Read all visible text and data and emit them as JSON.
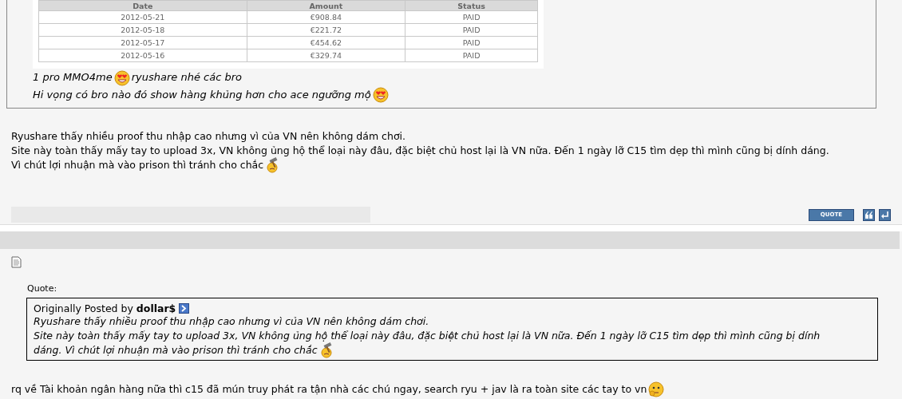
{
  "post_1": {
    "quote_table": {
      "columns": [
        "Date",
        "Amount",
        "Status"
      ],
      "rows": [
        [
          "2012-05-21",
          "€908.84",
          "PAID"
        ],
        [
          "2012-05-18",
          "€221.72",
          "PAID"
        ],
        [
          "2012-05-17",
          "€454.62",
          "PAID"
        ],
        [
          "2012-05-16",
          "€329.74",
          "PAID"
        ]
      ]
    },
    "quote_lines": [
      [
        {
          "kind": "text",
          "text": "1 pro MMO4me"
        },
        {
          "kind": "love_smiley"
        },
        {
          "kind": "text",
          "text": "ryushare nhé các bro"
        }
      ],
      [
        {
          "kind": "text",
          "text": "Hi vọng có bro nào đó show hàng khủng hơn cho ace ngưỡng mộ"
        },
        {
          "kind": "love_smiley"
        }
      ]
    ],
    "message_lines": [
      [
        {
          "kind": "text",
          "text": "Ryushare thấy nhiều proof thu nhập cao nhưng vì của VN nên không dám chơi."
        }
      ],
      [
        {
          "kind": "text",
          "text": "Site này toàn thấy mấy tay to upload 3x, VN không ủng hộ thể loại này đâu, đặc biệt chủ host lại là VN nữa. Đến 1 ngày lỡ C15 tìm dẹp thì mình cũng bị dính dáng."
        }
      ],
      [
        {
          "kind": "text",
          "text": "Vì chút lợi nhuận mà vào prison thì tránh cho chắc"
        },
        {
          "kind": "hammer_smiley"
        }
      ]
    ],
    "quote_button": "QUOTE"
  },
  "post_2": {
    "quote_label": "Quote:",
    "posted_by_label": "Originally Posted by",
    "author": "dollar$",
    "quote_lines": [
      [
        {
          "kind": "text",
          "text": "Ryushare thấy nhiều proof thu nhập cao nhưng vì của VN nên không dám chơi."
        }
      ],
      [
        {
          "kind": "text",
          "text": "Site này toàn thấy mấy tay to upload 3x, VN không ủng hộ thể loại này đâu, đặc biệt chủ host lại là VN nữa. Đến 1 ngày lỡ C15 tìm dẹp thì mình cũng bị dính"
        }
      ],
      [
        {
          "kind": "text",
          "text": "dáng. Vì chút lợi nhuận mà vào prison thì tránh cho chắc"
        },
        {
          "kind": "hammer_smiley"
        }
      ]
    ],
    "message_lines": [
      [
        {
          "kind": "text",
          "text": "rq về Tài khoản ngân hàng nữa thì c15 đã mún truy phát ra tận nhà các chú ngay, search ryu + jav là ra toàn site các tay to vn"
        },
        {
          "kind": "thinking_smiley"
        }
      ]
    ]
  }
}
